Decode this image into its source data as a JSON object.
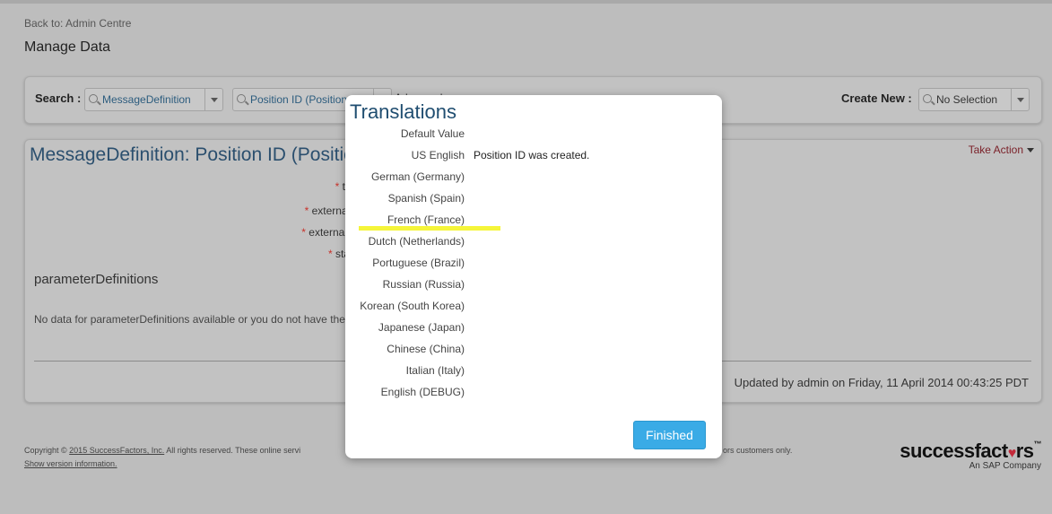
{
  "nav": {
    "back_link": "Back to: Admin Centre",
    "page_title": "Manage Data"
  },
  "search": {
    "label": "Search :",
    "object_type": "MessageDefinition",
    "record": "Position ID (Position ID was created.)",
    "advanced_link": "Advanced",
    "create_new_label": "Create New :",
    "create_new_value": "No Selection"
  },
  "record": {
    "title": "MessageDefinition: Position ID (Position ID was created.)",
    "take_action": "Take Action",
    "fields": [
      {
        "label": "text"
      },
      {
        "label": "externalCode"
      },
      {
        "label": "externalName"
      },
      {
        "label": "status"
      }
    ],
    "section_heading": "parameterDefinitions",
    "no_data": "No data for parameterDefinitions available or you do not have the",
    "updated": "Updated by admin on Friday, 11 April 2014 00:43:25 PDT"
  },
  "footer": {
    "copyright_prefix": "Copyright ©",
    "copyright_link": "2015 SuccessFactors, Inc.",
    "copyright_suffix": " All rights reserved. These online servi",
    "copyright_tail": "ors customers only.",
    "version_link": "Show version information.",
    "brand_name_a": "successfact",
    "brand_name_heart": "♥",
    "brand_name_b": "rs",
    "brand_tm": "™",
    "brand_sub": "An SAP Company"
  },
  "modal": {
    "title": "Translations",
    "rows": [
      {
        "language": "Default Value",
        "value": ""
      },
      {
        "language": "US English",
        "value": "Position ID was created."
      },
      {
        "language": "German (Germany)",
        "value": ""
      },
      {
        "language": "Spanish (Spain)",
        "value": ""
      },
      {
        "language": "French (France)",
        "value": ""
      },
      {
        "language": "Dutch (Netherlands)",
        "value": ""
      },
      {
        "language": "Portuguese (Brazil)",
        "value": ""
      },
      {
        "language": "Russian (Russia)",
        "value": ""
      },
      {
        "language": "Korean (South Korea)",
        "value": ""
      },
      {
        "language": "Japanese (Japan)",
        "value": ""
      },
      {
        "language": "Chinese (China)",
        "value": ""
      },
      {
        "language": "Italian (Italy)",
        "value": ""
      },
      {
        "language": "English (DEBUG)",
        "value": ""
      }
    ],
    "finished_label": "Finished"
  },
  "colors": {
    "accent": "#3aabe6",
    "title_blue": "#1f4d70",
    "required": "#c8322a",
    "highlight": "#f5f53a",
    "take_action": "#7a1f27"
  }
}
